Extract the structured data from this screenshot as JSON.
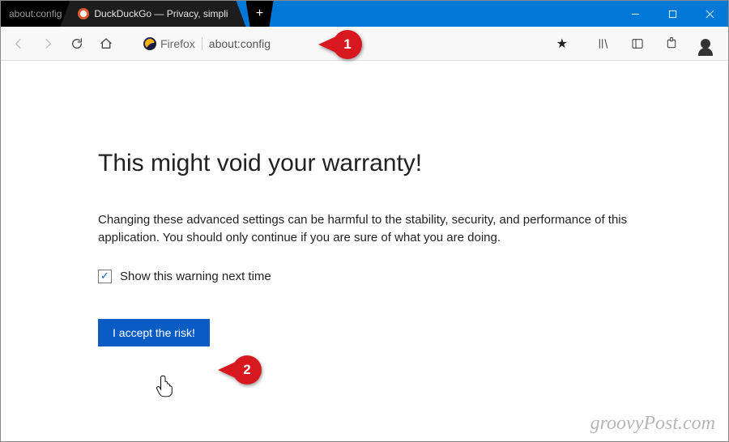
{
  "tabs": {
    "inactive": {
      "title": "about:config"
    },
    "active": {
      "title": "DuckDuckGo — Privacy, simpli"
    }
  },
  "urlbar": {
    "identity_label": "Firefox",
    "url_text": "about:config"
  },
  "warning": {
    "heading": "This might void your warranty!",
    "body": "Changing these advanced settings can be harmful to the stability, security, and performance of this application. You should only continue if you are sure of what you are doing.",
    "checkbox_label": "Show this warning next time",
    "checkbox_checked": true,
    "accept_label": "I accept the risk!"
  },
  "callouts": {
    "one": "1",
    "two": "2"
  },
  "watermark": "groovyPost.com"
}
